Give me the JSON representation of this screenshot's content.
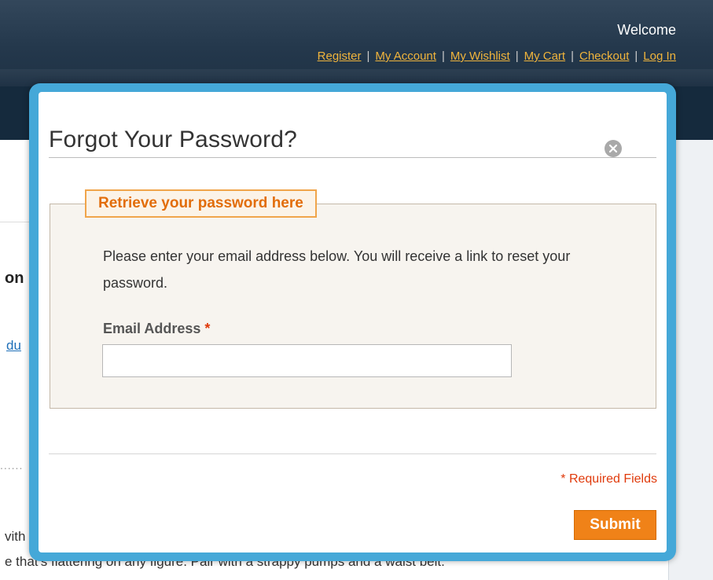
{
  "header": {
    "welcome_text": "Welcome",
    "links": [
      "Register",
      "My Account",
      "My Wishlist",
      "My Cart",
      "Checkout",
      "Log In"
    ]
  },
  "background": {
    "heading_fragment": "on",
    "link_fragment": "du",
    "dots": "......",
    "text_line1": "vith",
    "text_line2": "e that's flattering on any figure. Pair with a strappy pumps and a waist belt."
  },
  "modal": {
    "title": "Forgot Your Password?",
    "close_icon": "close-icon",
    "legend": "Retrieve your password here",
    "instructions": "Please enter your email address below. You will receive a link to reset your password.",
    "email_label": "Email Address",
    "required_star": "*",
    "email_value": "",
    "required_note": "* Required Fields",
    "submit_label": "Submit"
  },
  "colors": {
    "header": "#24384c",
    "link": "#f0b43c",
    "modal_frame": "#45a8d8",
    "legend_text": "#e26d0a",
    "required": "#e03a0b",
    "submit": "#f08218"
  }
}
